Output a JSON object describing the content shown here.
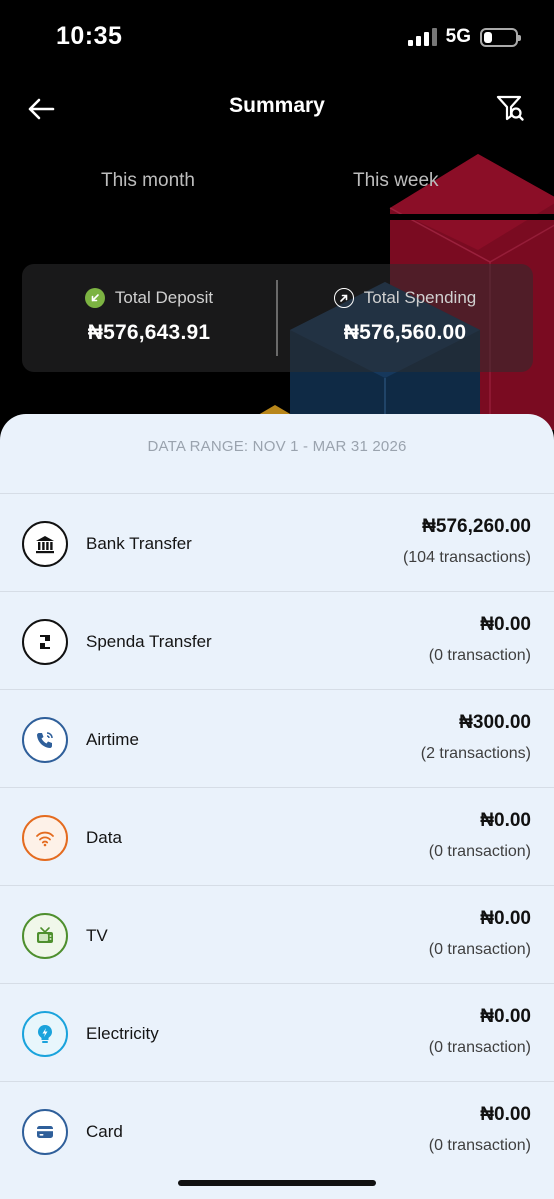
{
  "status_bar": {
    "time": "10:35",
    "network": "5G"
  },
  "header": {
    "title": "Summary"
  },
  "tabs": [
    {
      "label": "This month"
    },
    {
      "label": "This week"
    }
  ],
  "totals": {
    "deposit": {
      "label": "Total Deposit",
      "amount": "₦576,643.91"
    },
    "spending": {
      "label": "Total Spending",
      "amount": "₦576,560.00"
    }
  },
  "sheet": {
    "date_range": "DATA RANGE: NOV 1 - MAR 31 2026",
    "rows": [
      {
        "label": "Bank Transfer",
        "amount": "₦576,260.00",
        "count": "(104 transactions)",
        "icon": "bank-icon",
        "color": "#111111"
      },
      {
        "label": "Spenda Transfer",
        "amount": "₦0.00",
        "count": "(0 transaction)",
        "icon": "spenda-logo-icon",
        "color": "#111111"
      },
      {
        "label": "Airtime",
        "amount": "₦300.00",
        "count": "(2 transactions)",
        "icon": "phone-icon",
        "color": "#2f5f9a"
      },
      {
        "label": "Data",
        "amount": "₦0.00",
        "count": "(0 transaction)",
        "icon": "wifi-icon",
        "color": "#e46b1f"
      },
      {
        "label": "TV",
        "amount": "₦0.00",
        "count": "(0 transaction)",
        "icon": "tv-icon",
        "color": "#4e8f2e"
      },
      {
        "label": "Electricity",
        "amount": "₦0.00",
        "count": "(0 transaction)",
        "icon": "bulb-icon",
        "color": "#1aa3dc"
      },
      {
        "label": "Card",
        "amount": "₦0.00",
        "count": "(0 transaction)",
        "icon": "card-icon",
        "color": "#2f5f9a"
      }
    ]
  },
  "colors": {
    "deposit_accent": "#7cb342",
    "sheet_bg": "#eaf2fb"
  }
}
